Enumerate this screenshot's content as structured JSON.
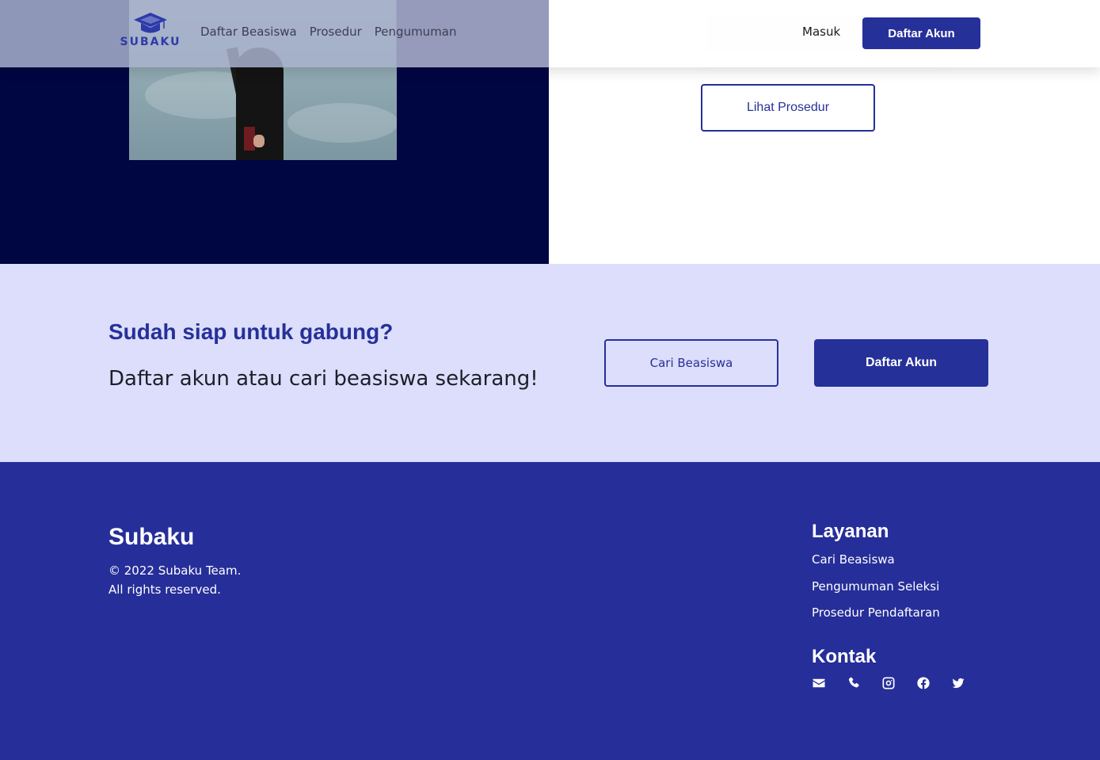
{
  "header": {
    "logo_text": "SUBAKU",
    "nav_links": [
      "Daftar Beasiswa",
      "Prosedur",
      "Pengumuman"
    ],
    "login_label": "Masuk",
    "register_label": "Daftar Akun"
  },
  "hero": {
    "procedure_button": "Lihat Prosedur"
  },
  "cta": {
    "heading": "Sudah siap untuk gabung?",
    "subheading": "Daftar akun atau cari beasiswa sekarang!",
    "search_button": "Cari Beasiswa",
    "register_button": "Daftar Akun"
  },
  "footer": {
    "brand": "Subaku",
    "copyright_line1": "© 2022 Subaku Team.",
    "copyright_line2": "All rights reserved.",
    "services_title": "Layanan",
    "services": [
      "Cari Beasiswa",
      "Pengumuman Seleksi",
      "Prosedur Pendaftaran"
    ],
    "contact_title": "Kontak",
    "contact_icons": [
      "envelope-icon",
      "phone-icon",
      "instagram-icon",
      "facebook-icon",
      "twitter-icon"
    ]
  },
  "colors": {
    "primary": "#263099",
    "hero_dark": "#000642",
    "cta_background": "#dcdefb",
    "footer_background": "#262e99"
  }
}
